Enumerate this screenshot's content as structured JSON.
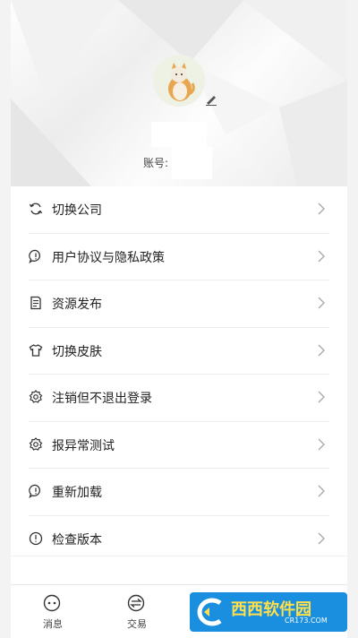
{
  "profile": {
    "account_label": "账号:"
  },
  "menu": [
    {
      "label": "切换公司",
      "icon": "refresh-icon"
    },
    {
      "label": "用户协议与隐私政策",
      "icon": "chat-bubble-icon"
    },
    {
      "label": "资源发布",
      "icon": "document-icon"
    },
    {
      "label": "切换皮肤",
      "icon": "tshirt-icon"
    },
    {
      "label": "注销但不退出登录",
      "icon": "gear-icon"
    },
    {
      "label": "报异常测试",
      "icon": "gear-icon"
    },
    {
      "label": "重新加载",
      "icon": "alert-bubble-icon"
    },
    {
      "label": "检查版本",
      "icon": "info-circle-icon"
    }
  ],
  "tabs": [
    {
      "label": "消息",
      "icon": "message-icon"
    },
    {
      "label": "交易",
      "icon": "exchange-icon"
    }
  ],
  "watermark": {
    "brand": "西西软件园",
    "url": "CR173.COM"
  },
  "colors": {
    "accent": "#1a8fe0",
    "text": "#222222",
    "divider": "#ececec"
  }
}
